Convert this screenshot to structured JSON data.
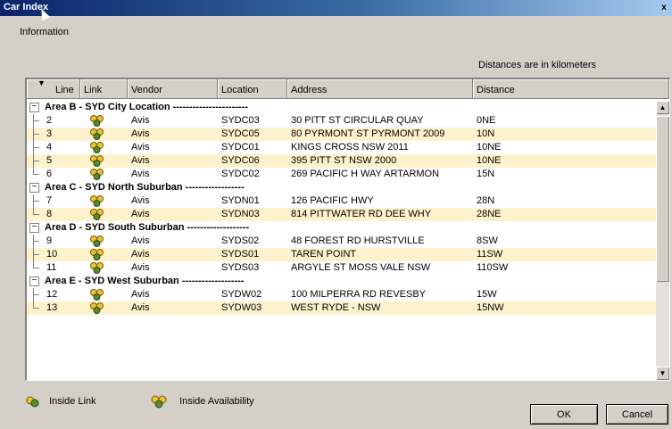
{
  "window": {
    "title": "Car Index",
    "close_label": "x"
  },
  "menu": {
    "information": "Information"
  },
  "note": "Distances are in kilometers",
  "columns": {
    "line": "Line",
    "link": "Link",
    "vendor": "Vendor",
    "location": "Location",
    "address": "Address",
    "distance": "Distance"
  },
  "groups": [
    {
      "label": "Area B - SYD City Location -----------------------",
      "rows": [
        {
          "line": "2",
          "vendor": "Avis",
          "location": "SYDC03",
          "address": "30 PITT ST CIRCULAR QUAY",
          "distance": "0NE"
        },
        {
          "line": "3",
          "vendor": "Avis",
          "location": "SYDC05",
          "address": "80 PYRMONT ST PYRMONT 2009",
          "distance": "10N"
        },
        {
          "line": "4",
          "vendor": "Avis",
          "location": "SYDC01",
          "address": "KINGS CROSS NSW 2011",
          "distance": "10NE"
        },
        {
          "line": "5",
          "vendor": "Avis",
          "location": "SYDC06",
          "address": "395 PITT ST NSW 2000",
          "distance": "10NE"
        },
        {
          "line": "6",
          "vendor": "Avis",
          "location": "SYDC02",
          "address": "269 PACIFIC H WAY ARTARMON",
          "distance": "15N"
        }
      ]
    },
    {
      "label": "Area C - SYD North Suburban ------------------",
      "rows": [
        {
          "line": "7",
          "vendor": "Avis",
          "location": "SYDN01",
          "address": "126 PACIFIC HWY",
          "distance": "28N"
        },
        {
          "line": "8",
          "vendor": "Avis",
          "location": "SYDN03",
          "address": "814 PITTWATER RD DEE WHY",
          "distance": "28NE"
        }
      ]
    },
    {
      "label": "Area D - SYD South Suburban -------------------",
      "rows": [
        {
          "line": "9",
          "vendor": "Avis",
          "location": "SYDS02",
          "address": "48 FOREST RD HURSTVILLE",
          "distance": "8SW"
        },
        {
          "line": "10",
          "vendor": "Avis",
          "location": "SYDS01",
          "address": "TAREN POINT",
          "distance": "11SW"
        },
        {
          "line": "11",
          "vendor": "Avis",
          "location": "SYDS03",
          "address": "ARGYLE ST MOSS VALE NSW",
          "distance": "110SW"
        }
      ]
    },
    {
      "label": "Area E - SYD West Suburban -------------------",
      "rows": [
        {
          "line": "12",
          "vendor": "Avis",
          "location": "SYDW02",
          "address": "100 MILPERRA RD REVESBY",
          "distance": "15W"
        },
        {
          "line": "13",
          "vendor": "Avis",
          "location": "SYDW03",
          "address": "WEST RYDE - NSW",
          "distance": "15NW"
        }
      ]
    }
  ],
  "legend": {
    "inside_link": "Inside Link",
    "inside_availability": "Inside Availability"
  },
  "buttons": {
    "ok": "OK",
    "cancel": "Cancel"
  },
  "colors": {
    "row_alt": "#fdf2cc",
    "icon_yellow": "#e8c23a",
    "icon_green": "#5a8a2a"
  }
}
